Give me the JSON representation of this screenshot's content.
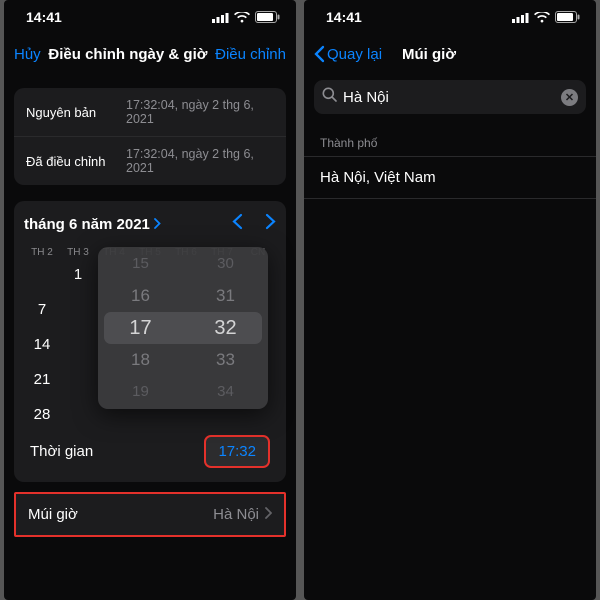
{
  "statusbar": {
    "time": "14:41"
  },
  "left": {
    "nav": {
      "cancel": "Hủy",
      "title": "Điều chỉnh ngày & giờ",
      "action": "Điều chỉnh"
    },
    "info": {
      "orig_label": "Nguyên bản",
      "orig_value": "17:32:04, ngày 2 thg 6, 2021",
      "adj_label": "Đã điều chỉnh",
      "adj_value": "17:32:04, ngày 2 thg 6, 2021"
    },
    "cal": {
      "month": "tháng 6 năm 2021",
      "dow": [
        "TH 2",
        "TH 3",
        "TH 4",
        "TH 5",
        "TH 6",
        "TH 7",
        "CN"
      ],
      "weeks": [
        [
          "",
          "1",
          "",
          "",
          "",
          "",
          ""
        ],
        [
          "7",
          "",
          "",
          "",
          "",
          "",
          ""
        ],
        [
          "14",
          "",
          "",
          "",
          "",
          "",
          ""
        ],
        [
          "21",
          "",
          "",
          "",
          "",
          "",
          ""
        ],
        [
          "28",
          "",
          "",
          "",
          "",
          "",
          ""
        ]
      ]
    },
    "picker": {
      "hours": [
        "15",
        "16",
        "17",
        "18",
        "19"
      ],
      "mins": [
        "30",
        "31",
        "32",
        "33",
        "34"
      ]
    },
    "time_label": "Thời gian",
    "time_value": "17:32",
    "tz_label": "Múi giờ",
    "tz_value": "Hà Nội"
  },
  "right": {
    "nav": {
      "back": "Quay lại",
      "title": "Múi giờ"
    },
    "search": {
      "value": "Hà Nội"
    },
    "section": "Thành phố",
    "result": "Hà Nội, Việt Nam"
  }
}
